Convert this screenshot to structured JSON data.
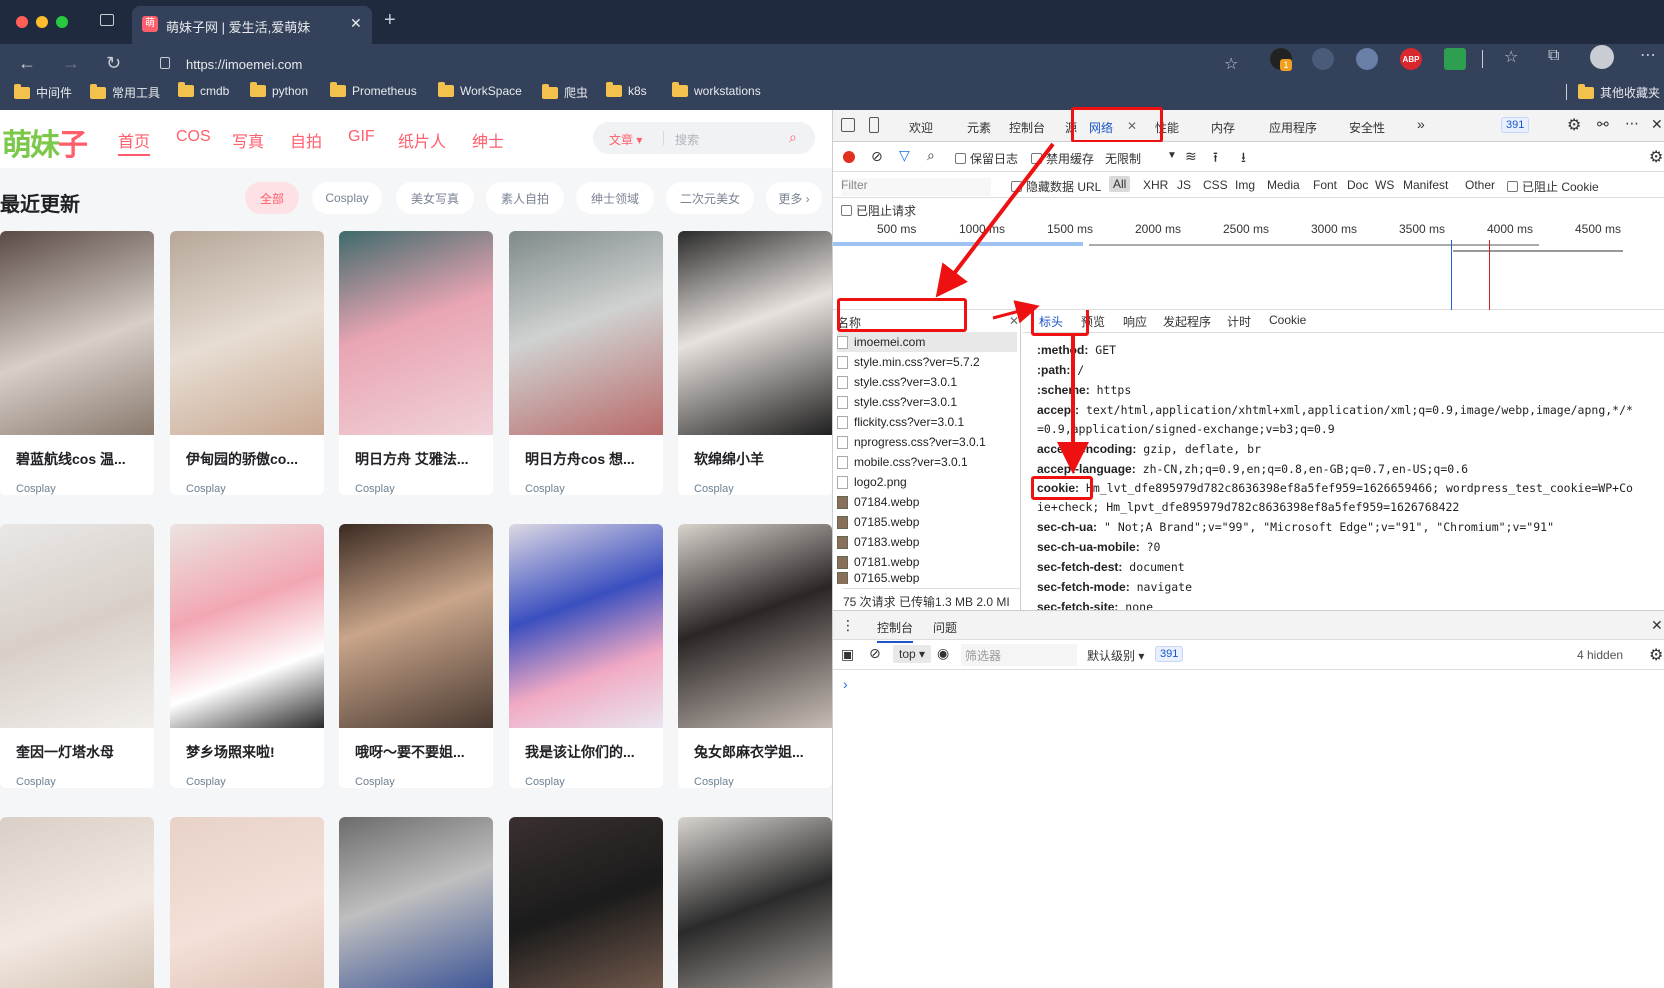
{
  "browser": {
    "tab_title": "萌妹子网 | 爱生活,爱萌妹",
    "tab_favicon": "萌",
    "url": "https://imoemei.com",
    "bookmarks": [
      "中间件",
      "常用工具",
      "cmdb",
      "python",
      "Prometheus",
      "WorkSpace",
      "爬虫",
      "k8s",
      "workstations"
    ],
    "other_bookmarks": "其他收藏夹",
    "ext_badge": "1",
    "abp": "ABP"
  },
  "site": {
    "logo_main": "萌妹",
    "logo_accent": "子",
    "nav": [
      "首页",
      "COS",
      "写真",
      "自拍",
      "GIF",
      "纸片人",
      "绅士"
    ],
    "article_menu": "文章 ▾",
    "search_placeholder": "搜索",
    "section_title": "最近更新",
    "filters": [
      "全部",
      "Cosplay",
      "美女写真",
      "素人自拍",
      "绅士领域",
      "二次元美女",
      "更多 ›"
    ],
    "cards": [
      {
        "title": "碧蓝航线cos 温...",
        "cat": "Cosplay"
      },
      {
        "title": "伊甸园的骄傲co...",
        "cat": "Cosplay"
      },
      {
        "title": "明日方舟 艾雅法...",
        "cat": "Cosplay"
      },
      {
        "title": "明日方舟cos 想...",
        "cat": "Cosplay"
      },
      {
        "title": "软绵绵小羊",
        "cat": "Cosplay"
      },
      {
        "title": "奎因一灯塔水母",
        "cat": "Cosplay"
      },
      {
        "title": "梦乡场照来啦!",
        "cat": "Cosplay"
      },
      {
        "title": "哦呀～要不要姐...",
        "cat": "Cosplay"
      },
      {
        "title": "我是该让你们的...",
        "cat": "Cosplay"
      },
      {
        "title": "兔女郎麻衣学姐...",
        "cat": "Cosplay"
      }
    ]
  },
  "devtools": {
    "tabs": [
      "欢迎",
      "元素",
      "控制台",
      "源",
      "网络",
      "性能",
      "内存",
      "应用程序",
      "安全性",
      "»"
    ],
    "issue_count": "391",
    "toolbar": {
      "preserve_log": "保留日志",
      "disable_cache": "禁用缓存",
      "throttle": "无限制"
    },
    "filter": {
      "placeholder": "Filter",
      "hide_data_urls": "隐藏数据 URL",
      "types": [
        "All",
        "XHR",
        "JS",
        "CSS",
        "Img",
        "Media",
        "Font",
        "Doc",
        "WS",
        "Manifest",
        "Other"
      ],
      "block_cookies": "已阻止 Cookie",
      "blocked_requests": "已阻止请求"
    },
    "timeline_ticks": [
      "500 ms",
      "1000 ms",
      "1500 ms",
      "2000 ms",
      "2500 ms",
      "3000 ms",
      "3500 ms",
      "4000 ms",
      "4500 ms"
    ],
    "name_col": "名称",
    "requests": [
      "imoemei.com",
      "style.min.css?ver=5.7.2",
      "style.css?ver=3.0.1",
      "style.css?ver=3.0.1",
      "flickity.css?ver=3.0.1",
      "nprogress.css?ver=3.0.1",
      "mobile.css?ver=3.0.1",
      "logo2.png",
      "07184.webp",
      "07185.webp",
      "07183.webp",
      "07181.webp",
      "07165.webp"
    ],
    "summary": "75 次请求  已传输1.3 MB  2.0 MI",
    "detail_tabs": [
      "标头",
      "预览",
      "响应",
      "发起程序",
      "计时",
      "Cookie"
    ],
    "headers": [
      {
        "k": ":method:",
        "v": "GET"
      },
      {
        "k": ":path:",
        "v": "/"
      },
      {
        "k": ":scheme:",
        "v": "https"
      },
      {
        "k": "accept:",
        "v": "text/html,application/xhtml+xml,application/xml;q=0.9,image/webp,image/apng,*/*"
      },
      {
        "k": "",
        "v": "=0.9,application/signed-exchange;v=b3;q=0.9"
      },
      {
        "k": "accept-encoding:",
        "v": "gzip, deflate, br"
      },
      {
        "k": "accept-language:",
        "v": "zh-CN,zh;q=0.9,en;q=0.8,en-GB;q=0.7,en-US;q=0.6"
      },
      {
        "k": "cookie:",
        "v": "Hm_lvt_dfe895979d782c8636398ef8a5fef959=1626659466; wordpress_test_cookie=WP+Co"
      },
      {
        "k": "",
        "v": "ie+check; Hm_lpvt_dfe895979d782c8636398ef8a5fef959=1626768422"
      },
      {
        "k": "sec-ch-ua:",
        "v": "\" Not;A Brand\";v=\"99\", \"Microsoft Edge\";v=\"91\", \"Chromium\";v=\"91\""
      },
      {
        "k": "sec-ch-ua-mobile:",
        "v": "?0"
      },
      {
        "k": "sec-fetch-dest:",
        "v": "document"
      },
      {
        "k": "sec-fetch-mode:",
        "v": "navigate"
      },
      {
        "k": "sec-fetch-site:",
        "v": "none"
      }
    ],
    "console": {
      "tabs": [
        "控制台",
        "问题"
      ],
      "context": "top ▾",
      "filter_placeholder": "筛选器",
      "level": "默认级别 ▾",
      "count": "391",
      "hidden": "4 hidden",
      "prompt": "›"
    }
  }
}
